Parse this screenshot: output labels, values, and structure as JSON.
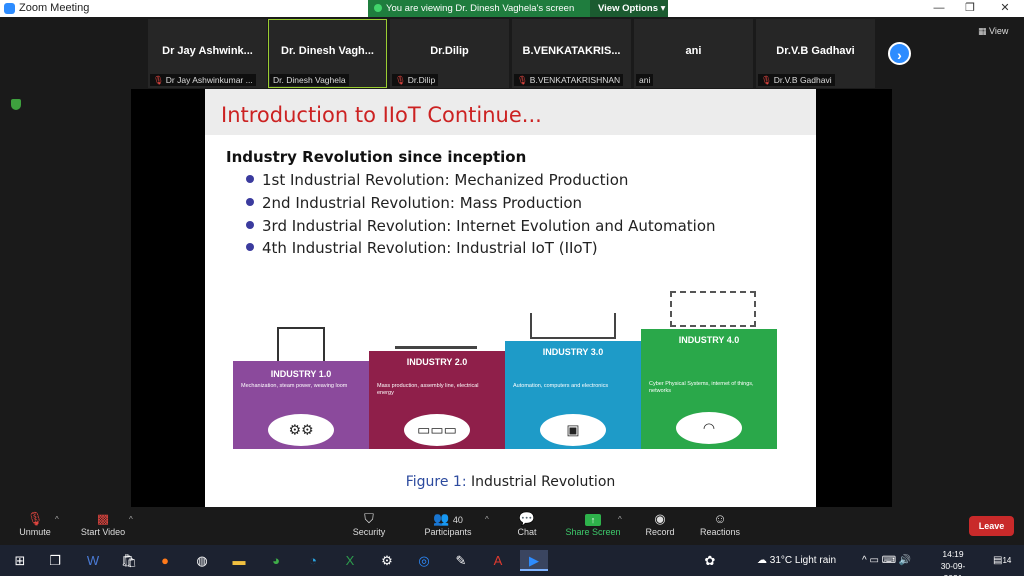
{
  "window": {
    "title": "Zoom Meeting",
    "share_banner": "You are viewing Dr. Dinesh Vaghela's screen",
    "view_options": "View Options",
    "minimize": "—",
    "restore": "❐",
    "close": "✕"
  },
  "gallery": {
    "tiles": [
      {
        "name": "Dr Jay Ashwink...",
        "label": "Dr Jay Ashwinkumar ...",
        "muted": true
      },
      {
        "name": "Dr. Dinesh Vagh...",
        "label": "Dr. Dinesh Vaghela",
        "muted": false
      },
      {
        "name": "Dr.Dilip",
        "label": "Dr.Dilip",
        "muted": true
      },
      {
        "name": "B.VENKATAKRIS...",
        "label": "B.VENKATAKRISHNAN",
        "muted": true
      },
      {
        "name": "ani",
        "label": "ani",
        "muted": false
      },
      {
        "name": "Dr.V.B Gadhavi",
        "label": "Dr.V.B Gadhavi",
        "muted": true
      }
    ],
    "view_label": "View"
  },
  "slide": {
    "title": "Introduction to IIoT Continue...",
    "heading": "Industry Revolution since inception",
    "bullets": [
      "1st Industrial Revolution: Mechanized Production",
      "2nd Industrial Revolution: Mass Production",
      "3rd Industrial Revolution: Internet Evolution and Automation",
      "4th Industrial Revolution: Industrial IoT (IIoT)"
    ],
    "industries": [
      {
        "title": "INDUSTRY 1.0",
        "desc": "Mechanization, steam power, weaving loom",
        "color": "#8b4a9c"
      },
      {
        "title": "INDUSTRY 2.0",
        "desc": "Mass production, assembly line, electrical energy",
        "color": "#8f1f4a"
      },
      {
        "title": "INDUSTRY 3.0",
        "desc": "Automation, computers and electronics",
        "color": "#1e9bc8"
      },
      {
        "title": "INDUSTRY 4.0",
        "desc": "Cyber Physical Systems, internet of things, networks",
        "color": "#2aa84a"
      }
    ],
    "caption_fig": "Figure 1:",
    "caption_text": "Industrial Revolution"
  },
  "toolbar": {
    "unmute": "Unmute",
    "start_video": "Start Video",
    "security": "Security",
    "participants": "Participants",
    "participants_count": "40",
    "chat": "Chat",
    "share_screen": "Share Screen",
    "record": "Record",
    "reactions": "Reactions",
    "leave": "Leave"
  },
  "taskbar": {
    "weather": "31°C  Light rain",
    "time": "14:19",
    "date": "30-09-2021",
    "notifications": "14"
  }
}
